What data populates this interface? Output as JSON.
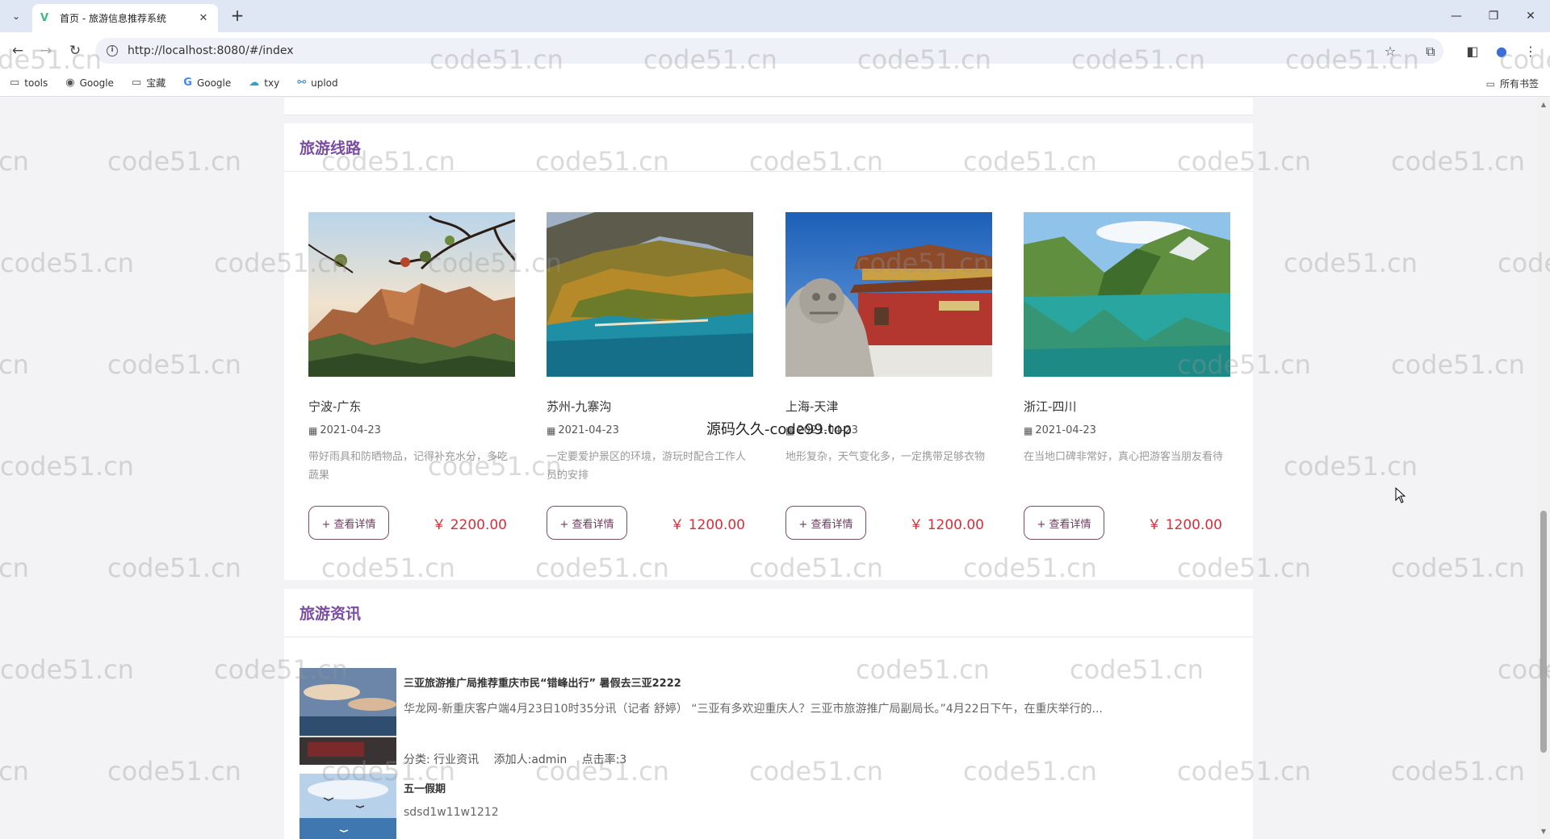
{
  "browser": {
    "tab_title": "首页 - 旅游信息推荐系统",
    "tab_close": "✕",
    "new_tab": "+",
    "url": "http://localhost:8080/#/index",
    "bookmarks": [
      {
        "icon": "folder-icon",
        "label": "tools"
      },
      {
        "icon": "globe-icon",
        "label": "Google"
      },
      {
        "icon": "folder-icon",
        "label": "宝藏"
      },
      {
        "icon": "google-icon",
        "label": "Google"
      },
      {
        "icon": "cloud-icon",
        "label": "txy"
      },
      {
        "icon": "link-icon",
        "label": "uplod"
      }
    ],
    "all_bookmarks": "所有书签"
  },
  "watermark": {
    "text": "code51.cn",
    "center_text": "源码久久-code99.top"
  },
  "routes": {
    "title": "旅游线路",
    "items": [
      {
        "name": "宁波-广东",
        "date": "2021-04-23",
        "desc": "带好雨具和防晒物品，记得补充水分，多吃蔬果",
        "button": "+ 查看详情",
        "price": "￥ 2200.00"
      },
      {
        "name": "苏州-九寨沟",
        "date": "2021-04-23",
        "desc": "一定要爱护景区的环境，游玩时配合工作人员的安排",
        "button": "+ 查看详情",
        "price": "￥ 1200.00"
      },
      {
        "name": "上海-天津",
        "date": "2021-04-23",
        "desc": "地形复杂，天气变化多，一定携带足够衣物",
        "button": "+ 查看详情",
        "price": "￥ 1200.00"
      },
      {
        "name": "浙江-四川",
        "date": "2021-04-23",
        "desc": "在当地口碑非常好，真心把游客当朋友看待",
        "button": "+ 查看详情",
        "price": "￥ 1200.00"
      }
    ]
  },
  "news": {
    "title": "旅游资讯",
    "items": [
      {
        "title": "三亚旅游推广局推荐重庆市民“错峰出行” 暑假去三亚2222",
        "summary": "华龙网-新重庆客户端4月23日10时35分讯（记者 舒婷） “三亚有多欢迎重庆人？三亚市旅游推广局副局长。”4月22日下午，在重庆举行的...",
        "category": "分类: 行业资讯",
        "author": "添加人:admin",
        "clicks": "点击率:3"
      },
      {
        "title": "五一假期",
        "summary": "sdsd1w11w1212"
      }
    ]
  }
}
